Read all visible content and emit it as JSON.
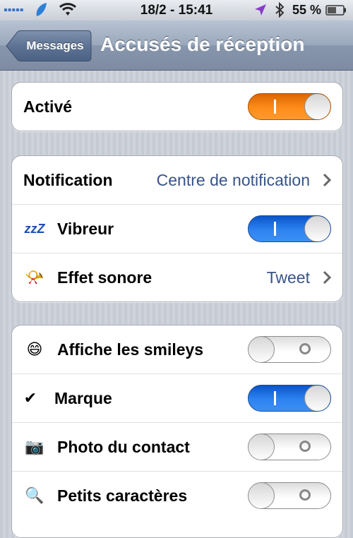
{
  "status_bar": {
    "signal": "▪▪▪▪▪",
    "time": "18/2 - 15:41",
    "battery_text": "55 %",
    "icons": [
      "signal-icon",
      "carrier-icon",
      "wifi-icon",
      "location-icon",
      "bluetooth-icon",
      "battery-icon"
    ]
  },
  "nav": {
    "back_label": "Messages",
    "title": "Accusés de réception"
  },
  "groups": [
    {
      "rows": [
        {
          "label": "Activé",
          "control": "toggle",
          "state": "on",
          "accent": "#ff8c1a"
        }
      ]
    },
    {
      "rows": [
        {
          "label": "Notification",
          "value": "Centre de notification",
          "control": "disclosure"
        },
        {
          "label": "Vibreur",
          "icon": "zzz-icon",
          "icon_glyph": "zzZ",
          "control": "toggle",
          "state": "on",
          "accent": "#2e83f0"
        },
        {
          "label": "Effet sonore",
          "icon": "megaphone-icon",
          "icon_glyph": "📯",
          "value": "Tweet",
          "control": "disclosure"
        }
      ]
    },
    {
      "rows": [
        {
          "label": "Affiche les smileys",
          "icon": "smiley-icon",
          "icon_glyph": "😄",
          "control": "toggle",
          "state": "off"
        },
        {
          "label": "Marque",
          "icon": "checkmark-icon",
          "icon_glyph": "✔",
          "control": "toggle",
          "state": "on",
          "accent": "#2e83f0"
        },
        {
          "label": "Photo du contact",
          "icon": "camera-icon",
          "icon_glyph": "📷",
          "control": "toggle",
          "state": "off"
        },
        {
          "label": "Petits caractères",
          "icon": "magnifier-icon",
          "icon_glyph": "🔍",
          "control": "toggle",
          "state": "off"
        }
      ]
    }
  ]
}
